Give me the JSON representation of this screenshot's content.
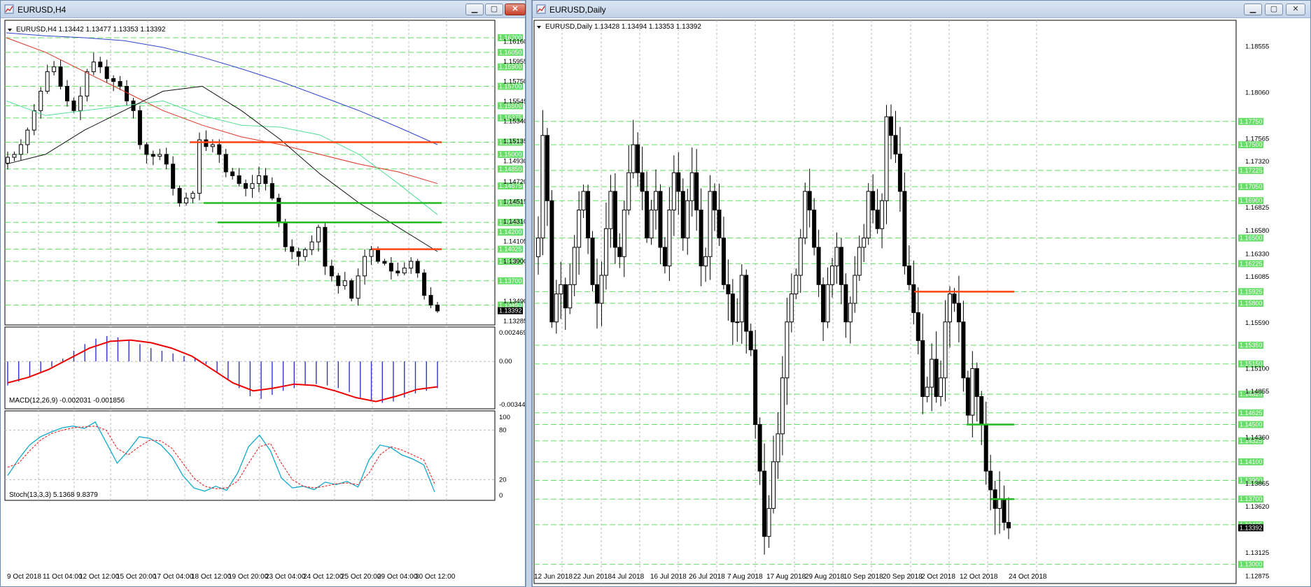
{
  "left_window": {
    "title": "EURUSD,H4",
    "header": "EURUSD,H4  1.13442 1.13477 1.13353 1.13392",
    "macd_label": "MACD(12,26,9) -0.002031 -0.001856",
    "stoch_label": "Stoch(13,3,3) 5.1368 9.8379",
    "macd_axis": [
      "0.002469",
      "0.00",
      "-0.003442"
    ],
    "stoch_axis": [
      "100",
      "80",
      "20",
      "0"
    ],
    "x_labels": [
      "9 Oct 2018",
      "11 Oct 04:00",
      "12 Oct 12:00",
      "15 Oct 20:00",
      "17 Oct 04:00",
      "18 Oct 12:00",
      "19 Oct 20:00",
      "23 Oct 04:00",
      "24 Oct 12:00",
      "25 Oct 20:00",
      "29 Oct 04:00",
      "30 Oct 12:00"
    ],
    "price_axis": [
      "1.16160",
      "1.15955",
      "1.15750",
      "1.15545",
      "1.15340",
      "1.15135",
      "1.14930",
      "1.14720",
      "1.14515",
      "1.14310",
      "1.14105",
      "1.13900",
      "1.13490",
      "1.13285"
    ],
    "level_tags": [
      "1.16200",
      "1.16050",
      "1.15900",
      "1.15700",
      "1.15500",
      "1.15375",
      "1.15125",
      "1.15000",
      "1.14850",
      "1.14675",
      "1.14500",
      "1.14300",
      "1.14200",
      "1.14025",
      "1.13900",
      "1.13700",
      "1.13450",
      "1.13392"
    ],
    "current_price": "1.13392",
    "lines": {
      "orange_upper": "1.15125",
      "green_upper": "1.14500",
      "green_lower": "1.14300",
      "orange_lower": "1.14025"
    }
  },
  "right_window": {
    "title": "EURUSD,Daily",
    "header": "EURUSD,Daily  1.13428 1.13494 1.13353 1.13392",
    "x_labels": [
      "12 Jun 2018",
      "22 Jun 2018",
      "4 Jul 2018",
      "16 Jul 2018",
      "26 Jul 2018",
      "7 Aug 2018",
      "17 Aug 2018",
      "29 Aug 2018",
      "10 Sep 2018",
      "20 Sep 2018",
      "2 Oct 2018",
      "12 Oct 2018",
      "24 Oct 2018"
    ],
    "price_axis": [
      "1.18555",
      "1.18060",
      "1.17565",
      "1.17320",
      "1.16825",
      "1.16580",
      "1.16330",
      "1.16085",
      "1.15590",
      "1.15100",
      "1.14855",
      "1.14360",
      "1.13865",
      "1.13620",
      "1.13125",
      "1.12875"
    ],
    "level_tags": [
      "1.17750",
      "1.17500",
      "1.17225",
      "1.17050",
      "1.16900",
      "1.16500",
      "1.16225",
      "1.15925",
      "1.15800",
      "1.15350",
      "1.15150",
      "1.14825",
      "1.14625",
      "1.14500",
      "1.14325",
      "1.14100",
      "1.13900",
      "1.13700",
      "1.13425",
      "1.13392",
      "1.13000"
    ],
    "current_price": "1.13392",
    "lines": {
      "orange": "1.15925",
      "green_upper": "1.14500",
      "green_lower": "1.13700"
    }
  },
  "colors": {
    "green_line": "#22bb22",
    "orange_line": "#ff4411",
    "level_tag": "#66dd66",
    "ma_blue": "#3344cc",
    "ma_red": "#dd3322",
    "ma_green": "#55dd99",
    "ma_black": "#111111",
    "macd_hist": "#3333cc",
    "macd_signal": "#ee0000",
    "stoch_main": "#11aacc",
    "stoch_signal": "#ee2222"
  },
  "icons": {
    "app": "chart-icon",
    "minimize": "minimize-icon",
    "maximize": "maximize-icon",
    "close": "close-icon",
    "dropdown": "dropdown-triangle-icon"
  }
}
